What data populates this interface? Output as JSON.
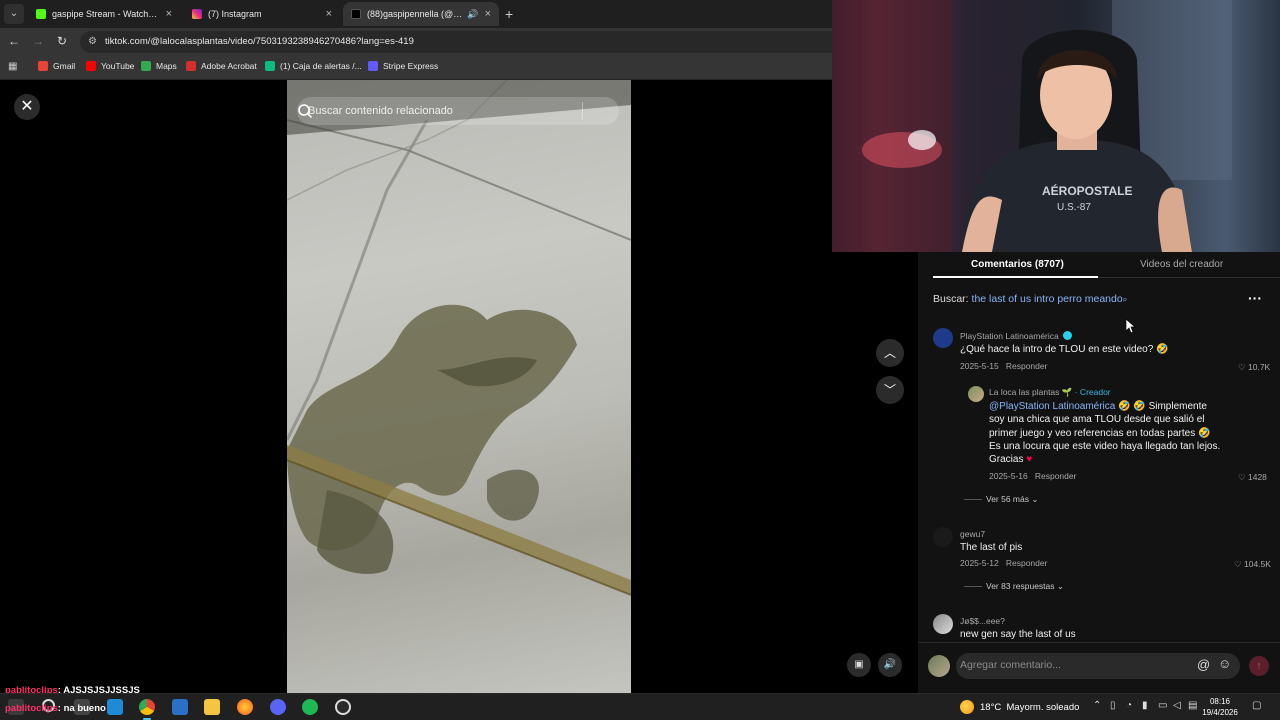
{
  "browser": {
    "tabs": [
      {
        "title": "gaspipe Stream - Watch Live on",
        "favicon_color": "#53fc18",
        "active": false
      },
      {
        "title": "(7) Instagram",
        "favicon_color": "#d6249f",
        "active": false
      },
      {
        "title": "(88)gaspipennella (@gaspi",
        "favicon_color": "#111111",
        "active": true
      }
    ],
    "url": "tiktok.com/@lalocalasplantas/video/7503193238946270486?lang=es-419",
    "bookmarks": [
      {
        "label": "Gmail",
        "color": "#ea4335"
      },
      {
        "label": "YouTube",
        "color": "#ff0000"
      },
      {
        "label": "Maps",
        "color": "#34a853"
      },
      {
        "label": "Adobe Acrobat",
        "color": "#d32f2f"
      },
      {
        "label": "(1) Caja de alertas /...",
        "color": "#10b981"
      },
      {
        "label": "Stripe Express",
        "color": "#635bff"
      }
    ]
  },
  "video": {
    "search_placeholder": "Buscar contenido relacionado"
  },
  "comments_panel": {
    "tab_comments": "Comentarios (8707)",
    "tab_creator_videos": "Videos del creador",
    "search_prefix": "Buscar:",
    "search_query": "the last of us intro perro meando",
    "comments": [
      {
        "author": "PlayStation Latinoamérica",
        "text": "¿Qué hace la intro de TLOU en este video? 🤣",
        "date": "2025-5-15",
        "reply_label": "Responder",
        "likes": "10.7K",
        "avatar_color": "#1f3a8a"
      },
      {
        "author": "La loca las plantas 🌱",
        "creator_label": "· Creador",
        "mention": "@PlayStation Latinoamérica",
        "text_l1_rest": "🤣 🤣 Simplemente",
        "text_l2": "soy una chica que ama TLOU desde que salió el",
        "text_l3": "primer juego y veo referencias en todas partes 🤣",
        "text_l4": "Es una locura que este video haya llegado tan lejos.",
        "text_l5": "Gracias",
        "date": "2025-5-16",
        "reply_label": "Responder",
        "likes": "1428",
        "more_replies": "Ver 56 más"
      },
      {
        "author": "gewu7",
        "text": "The last of pis",
        "date": "2025-5-12",
        "reply_label": "Responder",
        "likes": "104.5K",
        "more_replies": "Ver 83 respuestas"
      },
      {
        "author": "Jø$$...eee?",
        "text": "new gen say the last of us"
      }
    ],
    "add_comment_placeholder": "Agregar comentario..."
  },
  "chat_overlay": [
    {
      "user": "pablitoclips",
      "message": ": AJSJSJSJJSSJS"
    },
    {
      "user": "pablitoclips",
      "message": ": na bueno"
    }
  ],
  "taskbar": {
    "weather_temp": "18°C",
    "weather_desc": "Mayorm. soleado",
    "time": "08:16",
    "date": "19/4/2026"
  },
  "colors": {
    "accent_link": "#8ab4f8",
    "tiktok_red": "#fe2c55",
    "panel_bg": "#121212"
  }
}
